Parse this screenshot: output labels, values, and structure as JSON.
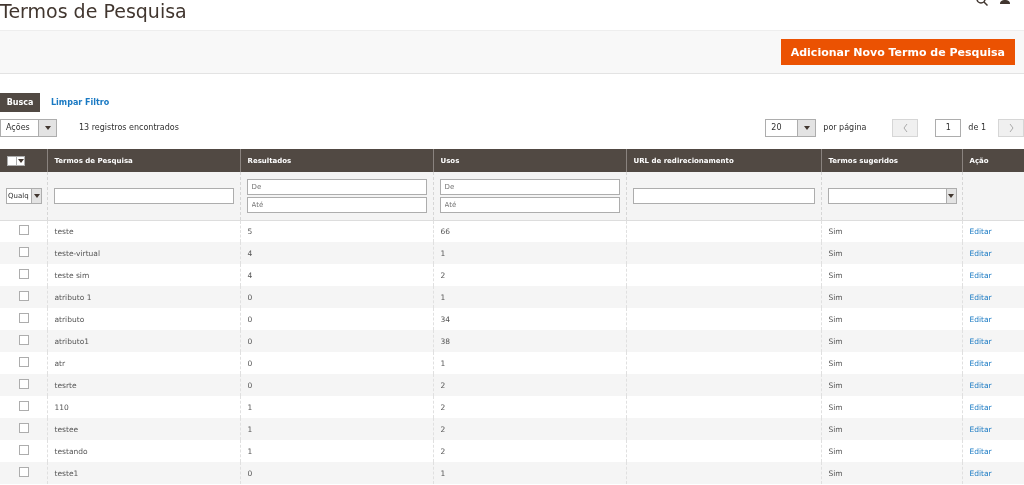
{
  "page_title": "Termos de Pesquisa",
  "add_button": "Adicionar Novo Termo de Pesquisa",
  "search_button": "Busca",
  "clear_filter": "Limpar Filtro",
  "actions_select": "Ações",
  "records_found": "13 registros encontrados",
  "per_page": {
    "value": "20",
    "label": "por página"
  },
  "pagination": {
    "page": "1",
    "of": "de 1"
  },
  "columns": [
    "Termos de Pesquisa",
    "Resultados",
    "Usos",
    "URL de redirecionamento",
    "Termos sugeridos",
    "Ação"
  ],
  "filters": {
    "mass_select": "Qualq",
    "ranges": [
      {
        "from": {
          "placeholder": "De"
        },
        "to": {
          "placeholder": "Até"
        }
      },
      {
        "from": {
          "placeholder": "De"
        },
        "to": {
          "placeholder": "Até"
        }
      }
    ]
  },
  "rows": [
    {
      "term": "teste",
      "results": "5",
      "uses": "66",
      "suggested": "Sim",
      "action": "Editar",
      "checked": false
    },
    {
      "term": "teste-virtual",
      "results": "4",
      "uses": "1",
      "suggested": "Sim",
      "action": "Editar",
      "checked": false
    },
    {
      "term": "teste sim",
      "results": "4",
      "uses": "2",
      "suggested": "Sim",
      "action": "Editar",
      "checked": false
    },
    {
      "term": "atributo 1",
      "results": "0",
      "uses": "1",
      "suggested": "Sim",
      "action": "Editar",
      "checked": false
    },
    {
      "term": "atributo",
      "results": "0",
      "uses": "34",
      "suggested": "Sim",
      "action": "Editar",
      "checked": false
    },
    {
      "term": "atributo1",
      "results": "0",
      "uses": "38",
      "suggested": "Sim",
      "action": "Editar",
      "checked": false
    },
    {
      "term": "atr",
      "results": "0",
      "uses": "1",
      "suggested": "Sim",
      "action": "Editar",
      "checked": false
    },
    {
      "term": "tesrte",
      "results": "0",
      "uses": "2",
      "suggested": "Sim",
      "action": "Editar",
      "checked": false
    },
    {
      "term": "110",
      "results": "1",
      "uses": "2",
      "suggested": "Sim",
      "action": "Editar",
      "checked": false
    },
    {
      "term": "testee",
      "results": "1",
      "uses": "2",
      "suggested": "Sim",
      "action": "Editar",
      "checked": false
    },
    {
      "term": "testando",
      "results": "1",
      "uses": "2",
      "suggested": "Sim",
      "action": "Editar",
      "checked": false
    },
    {
      "term": "teste1",
      "results": "0",
      "uses": "1",
      "suggested": "Sim",
      "action": "Editar",
      "checked": false
    }
  ]
}
